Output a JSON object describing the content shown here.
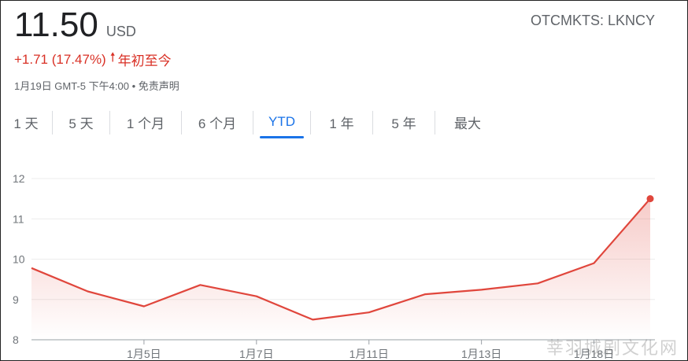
{
  "quote": {
    "price": "11.50",
    "currency": "USD",
    "change": "+1.71 (17.47%)",
    "change_period": "年初至今",
    "timestamp": "1月19日 GMT-5 下午4:00",
    "separator": "•",
    "disclaimer": "免责声明",
    "ticker": "OTCMKTS: LKNCY"
  },
  "tabs": [
    {
      "label": "1 天",
      "active": false
    },
    {
      "label": "5 天",
      "active": false
    },
    {
      "label": "1 个月",
      "active": false
    },
    {
      "label": "6 个月",
      "active": false
    },
    {
      "label": "YTD",
      "active": true
    },
    {
      "label": "1 年",
      "active": false
    },
    {
      "label": "5 年",
      "active": false
    },
    {
      "label": "最大",
      "active": false
    }
  ],
  "colors": {
    "up": "#d93025",
    "accent": "#1a73e8",
    "line": "#e0463c"
  },
  "chart_data": {
    "type": "line",
    "x": [
      0,
      1,
      2,
      3,
      4,
      5,
      6,
      7,
      8,
      9,
      10,
      11
    ],
    "values": [
      9.78,
      9.2,
      8.83,
      9.36,
      9.08,
      8.5,
      8.68,
      9.13,
      9.24,
      9.4,
      9.9,
      11.5
    ],
    "x_tick_positions": [
      2,
      4,
      6,
      8,
      10
    ],
    "x_tick_labels": [
      "1月5日",
      "1月7日",
      "1月11日",
      "1月13日",
      "1月18日"
    ],
    "y_ticks": [
      8,
      9,
      10,
      11,
      12
    ],
    "ylim": [
      8,
      12
    ],
    "grid": true
  },
  "watermark": "莘羽城剧文化网"
}
